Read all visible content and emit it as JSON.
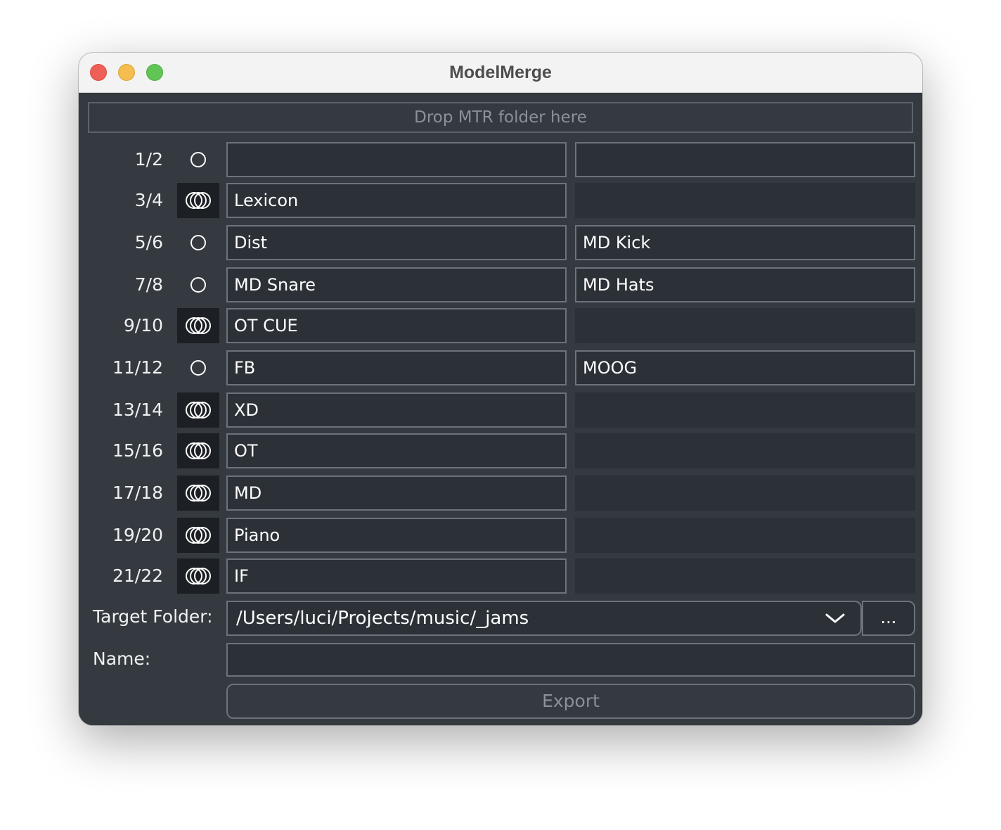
{
  "window": {
    "title": "ModelMerge"
  },
  "dropzone": {
    "label": "Drop MTR folder here"
  },
  "channels": [
    {
      "label": "1/2",
      "linked": false,
      "left": "",
      "right": ""
    },
    {
      "label": "3/4",
      "linked": true,
      "left": "Lexicon",
      "right": ""
    },
    {
      "label": "5/6",
      "linked": false,
      "left": "Dist",
      "right": "MD Kick"
    },
    {
      "label": "7/8",
      "linked": false,
      "left": "MD Snare",
      "right": "MD Hats"
    },
    {
      "label": "9/10",
      "linked": true,
      "left": "OT CUE",
      "right": ""
    },
    {
      "label": "11/12",
      "linked": false,
      "left": "FB",
      "right": "MOOG"
    },
    {
      "label": "13/14",
      "linked": true,
      "left": "XD",
      "right": ""
    },
    {
      "label": "15/16",
      "linked": true,
      "left": "OT",
      "right": ""
    },
    {
      "label": "17/18",
      "linked": true,
      "left": "MD",
      "right": ""
    },
    {
      "label": "19/20",
      "linked": true,
      "left": "Piano",
      "right": ""
    },
    {
      "label": "21/22",
      "linked": true,
      "left": "IF",
      "right": ""
    }
  ],
  "target_folder": {
    "label": "Target Folder:",
    "value": "/Users/luci/Projects/music/_jams",
    "browse_label": "..."
  },
  "name": {
    "label": "Name:",
    "value": ""
  },
  "export": {
    "label": "Export"
  },
  "colors": {
    "background": "#343a40",
    "field_background": "#2b3137",
    "field_border": "#6c737a",
    "active_link_background": "#1c2024"
  },
  "icons": {
    "mono": "single-circle-icon",
    "stereo": "linked-circles-icon",
    "dropdown": "chevron-down-icon"
  }
}
